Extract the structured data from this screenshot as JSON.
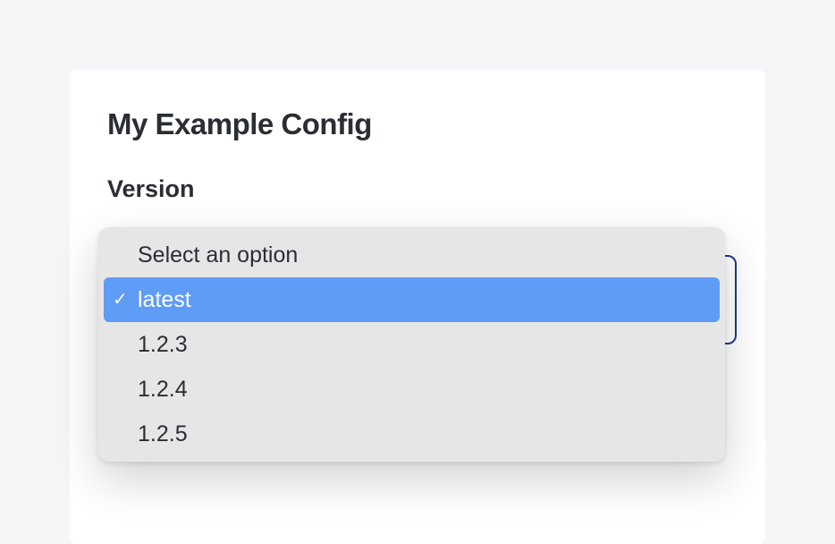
{
  "page": {
    "title": "My Example Config"
  },
  "section": {
    "version_label": "Version"
  },
  "dropdown": {
    "placeholder": "Select an option",
    "selected_value": "latest",
    "options": [
      {
        "value": "latest",
        "label": "latest"
      },
      {
        "value": "1.2.3",
        "label": "1.2.3"
      },
      {
        "value": "1.2.4",
        "label": "1.2.4"
      },
      {
        "value": "1.2.5",
        "label": "1.2.5"
      }
    ]
  },
  "icons": {
    "checkmark": "✓"
  }
}
